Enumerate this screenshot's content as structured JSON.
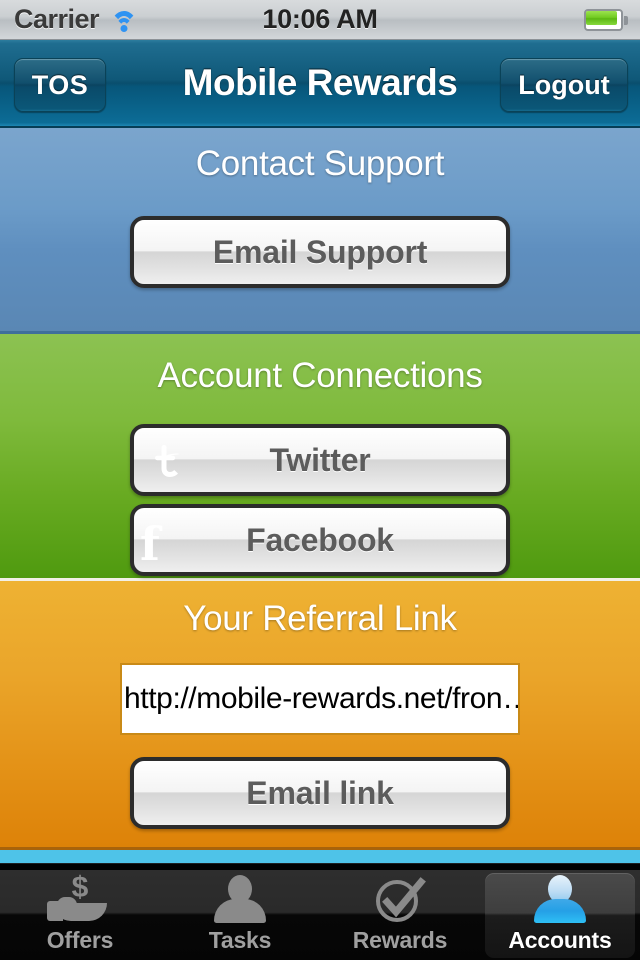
{
  "status_bar": {
    "carrier": "Carrier",
    "wifi_icon": "wifi-icon",
    "time": "10:06 AM",
    "battery_icon": "battery-full-icon"
  },
  "nav_bar": {
    "left_button": "TOS",
    "title": "Mobile Rewards",
    "right_button": "Logout"
  },
  "sections": {
    "support": {
      "title": "Contact Support",
      "email_support_button": "Email Support",
      "bg_color": "#6b9bc8"
    },
    "connections": {
      "title": "Account Connections",
      "twitter_button": "Twitter",
      "twitter_icon": "twitter-icon",
      "facebook_button": "Facebook",
      "facebook_icon": "facebook-icon",
      "facebook_glyph": "f",
      "bg_color": "#7fba3c"
    },
    "referral": {
      "title": "Your Referral Link",
      "link_value": "http://mobile-rewards.net/fron…",
      "email_link_button": "Email link",
      "bg_color": "#eaa52a"
    }
  },
  "tab_bar": {
    "tabs": [
      {
        "label": "Offers",
        "icon": "hand-dollar-icon",
        "selected": false
      },
      {
        "label": "Tasks",
        "icon": "person-icon",
        "selected": false
      },
      {
        "label": "Rewards",
        "icon": "check-circle-icon",
        "selected": false
      },
      {
        "label": "Accounts",
        "icon": "person-icon",
        "selected": true
      }
    ]
  },
  "colors": {
    "nav_accent": "#0a4e6d",
    "selected_tab": "#2ec0f5",
    "cyan_strip": "#4ec3e8"
  }
}
